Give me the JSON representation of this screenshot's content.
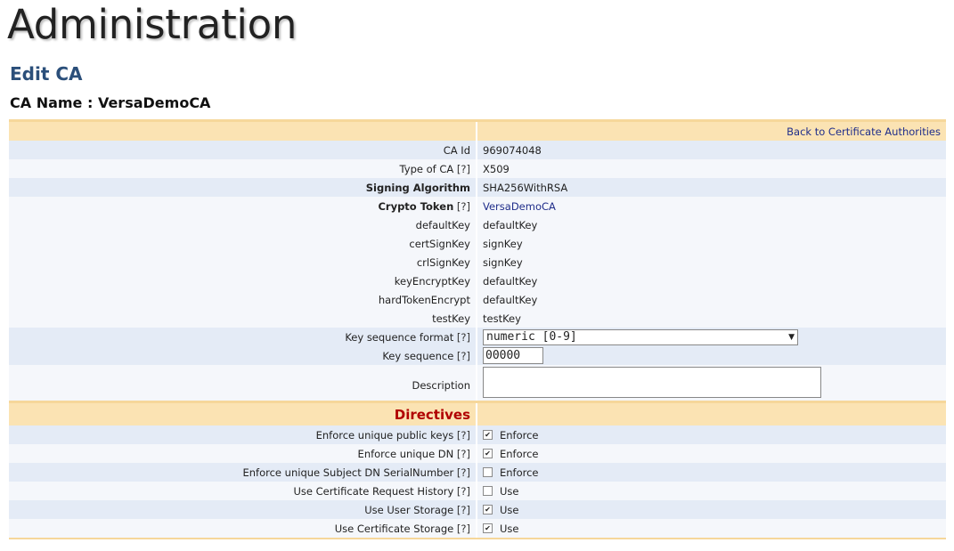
{
  "page": {
    "title": "Administration",
    "section": "Edit CA",
    "ca_name": "CA Name : VersaDemoCA"
  },
  "header_link": "Back to Certificate Authorities",
  "fields": {
    "ca_id": {
      "label": "CA Id",
      "value": "969074048"
    },
    "ca_type": {
      "label": "Type of CA",
      "help": "[?]",
      "value": "X509"
    },
    "signing_algorithm": {
      "label": "Signing Algorithm",
      "value": "SHA256WithRSA"
    },
    "crypto_token": {
      "label": "Crypto Token",
      "help": "[?]",
      "value": "VersaDemoCA"
    },
    "default_key": {
      "label": "defaultKey",
      "value": "defaultKey"
    },
    "cert_sign_key": {
      "label": "certSignKey",
      "value": "signKey"
    },
    "crl_sign_key": {
      "label": "crlSignKey",
      "value": "signKey"
    },
    "key_encrypt_key": {
      "label": "keyEncryptKey",
      "value": "defaultKey"
    },
    "hard_token_encrypt": {
      "label": "hardTokenEncrypt",
      "value": "defaultKey"
    },
    "test_key": {
      "label": "testKey",
      "value": "testKey"
    },
    "key_sequence_format": {
      "label": "Key sequence format",
      "help": "[?]",
      "value": "numeric [0-9]"
    },
    "key_sequence": {
      "label": "Key sequence",
      "help": "[?]",
      "value": "00000"
    },
    "description": {
      "label": "Description",
      "value": ""
    }
  },
  "directives": {
    "title": "Directives",
    "items": [
      {
        "label": "Enforce unique public keys",
        "help": "[?]",
        "option": "Enforce",
        "checked": true
      },
      {
        "label": "Enforce unique DN",
        "help": "[?]",
        "option": "Enforce",
        "checked": true
      },
      {
        "label": "Enforce unique Subject DN SerialNumber",
        "help": "[?]",
        "option": "Enforce",
        "checked": false
      },
      {
        "label": "Use Certificate Request History",
        "help": "[?]",
        "option": "Use",
        "checked": false
      },
      {
        "label": "Use User Storage",
        "help": "[?]",
        "option": "Use",
        "checked": true
      },
      {
        "label": "Use Certificate Storage",
        "help": "[?]",
        "option": "Use",
        "checked": true
      }
    ]
  },
  "colors": {
    "header_band": "#fbe3b3",
    "row_alt": "#e4ebf6",
    "row_light": "#f5f7fb",
    "title_blue": "#2b4f7a",
    "directives_red": "#b00000",
    "link_blue": "#1f2d8a"
  }
}
